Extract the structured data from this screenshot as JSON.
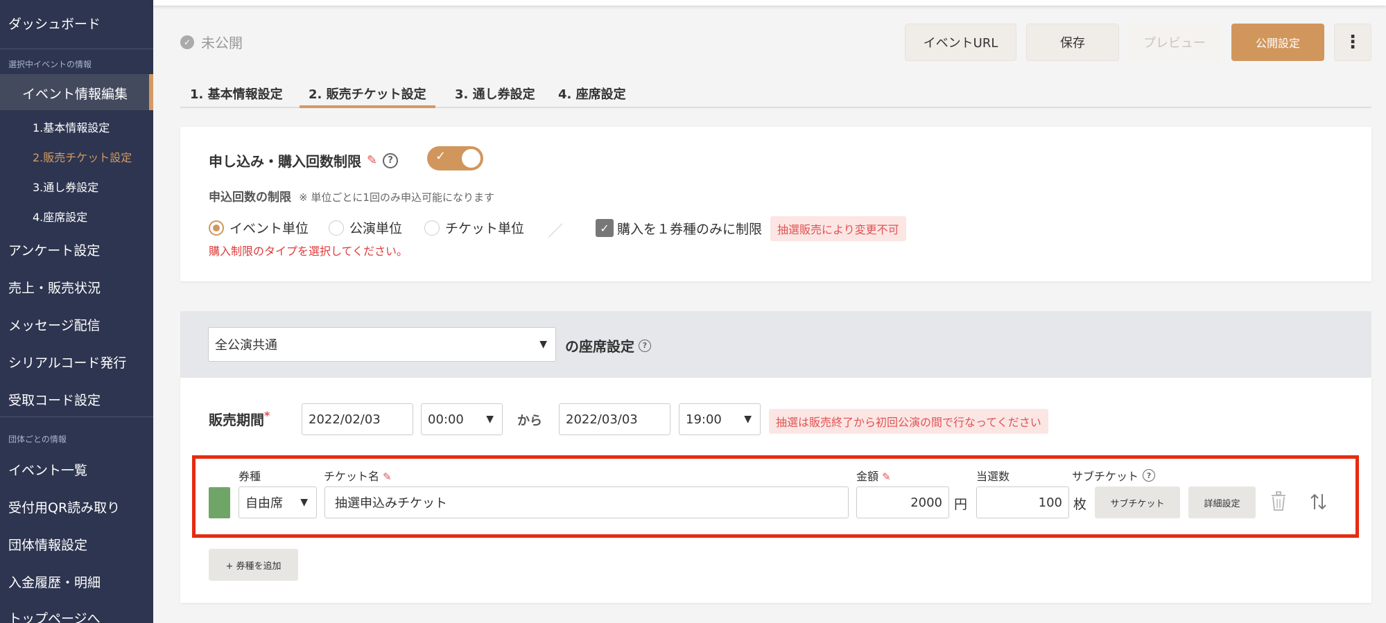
{
  "sidebar": {
    "dashboard": "ダッシュボード",
    "section_event": "選択中イベントの情報",
    "event_edit": "イベント情報編集",
    "sub_items": [
      "1.基本情報設定",
      "2.販売チケット設定",
      "3.通し券設定",
      "4.座席設定"
    ],
    "items": [
      "アンケート設定",
      "売上・販売状況",
      "メッセージ配信",
      "シリアルコード発行",
      "受取コード設定"
    ],
    "section_org": "団体ごとの情報",
    "org_items": [
      "イベント一覧",
      "受付用QR読み取り",
      "団体情報設定",
      "入金履歴・明細",
      "トップページへ"
    ]
  },
  "header": {
    "status": "未公開",
    "event_url": "イベントURL",
    "save": "保存",
    "preview": "プレビュー",
    "publish": "公開設定",
    "more": "⋮"
  },
  "tabs": [
    "1. 基本情報設定",
    "2. 販売チケット設定",
    "3. 通し券設定",
    "4. 座席設定"
  ],
  "limit": {
    "title": "申し込み・購入回数制限",
    "subtitle": "申込回数の制限",
    "note": "※ 単位ごとに1回のみ申込可能になります",
    "options": [
      "イベント単位",
      "公演単位",
      "チケット単位"
    ],
    "selected": "イベント単位",
    "checkbox_label": "購入を１券種のみに制限",
    "badge": "抽選販売により変更不可",
    "error": "購入制限のタイプを選択してください。",
    "toggle_on": true
  },
  "seat": {
    "performance": "全公演共通",
    "title": "の座席設定"
  },
  "sales": {
    "label": "販売期間",
    "required_mark": "*",
    "start_date": "2022/02/03",
    "start_time": "00:00",
    "from": "から",
    "end_date": "2022/03/03",
    "end_time": "19:00",
    "warning": "抽選は販売終了から初回公演の間で行なってください"
  },
  "ticket": {
    "headers": {
      "type": "券種",
      "name": "チケット名",
      "price": "金額",
      "count": "当選数",
      "sub": "サブチケット"
    },
    "type": "自由席",
    "name": "抽選申込みチケット",
    "price": "2000",
    "price_unit": "円",
    "count": "100",
    "count_unit": "枚",
    "sub_button": "サブチケット",
    "detail_button": "詳細設定",
    "color": "#6fa668"
  },
  "add_type": "+ 券種を追加"
}
